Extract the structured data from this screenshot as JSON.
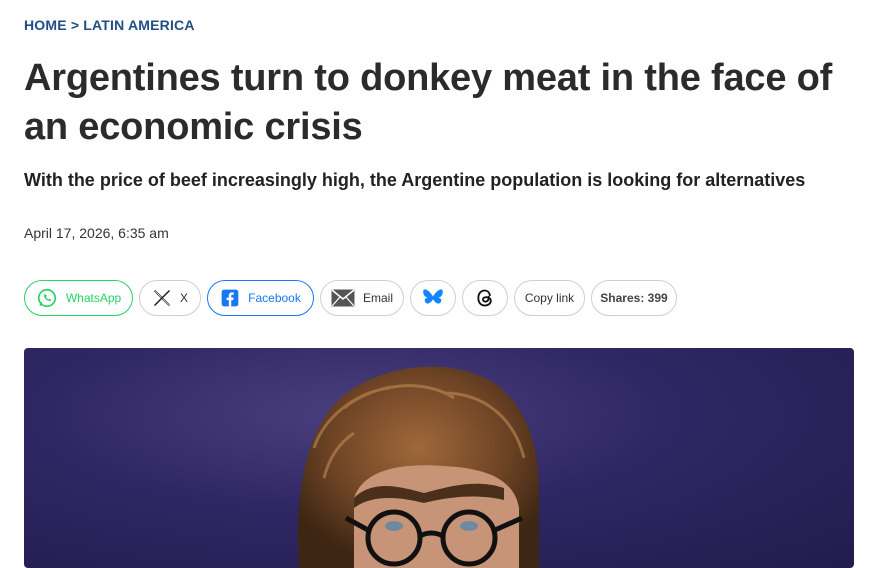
{
  "breadcrumb": {
    "home": "HOME",
    "separator": ">",
    "section": "LATIN AMERICA"
  },
  "article": {
    "title": "Argentines turn to donkey meat in the face of an economic crisis",
    "subtitle": "With the price of beef increasingly high, the Argentine population is looking for alternatives",
    "date": "April 17, 2026, 6:35 am"
  },
  "share": {
    "whatsapp": "WhatsApp",
    "x": "X",
    "facebook": "Facebook",
    "email": "Email",
    "copy_link": "Copy link",
    "shares": "Shares: 399"
  },
  "icons": {
    "whatsapp": "whatsapp-icon",
    "x": "x-logo-icon",
    "facebook": "facebook-icon",
    "email": "envelope-icon",
    "bluesky": "bluesky-butterfly-icon",
    "threads": "threads-icon"
  },
  "colors": {
    "breadcrumb": "#1f4f86",
    "whatsapp": "#25d366",
    "facebook": "#1877f2",
    "bluesky": "#1185fe",
    "hero_background": "#2f2763"
  }
}
